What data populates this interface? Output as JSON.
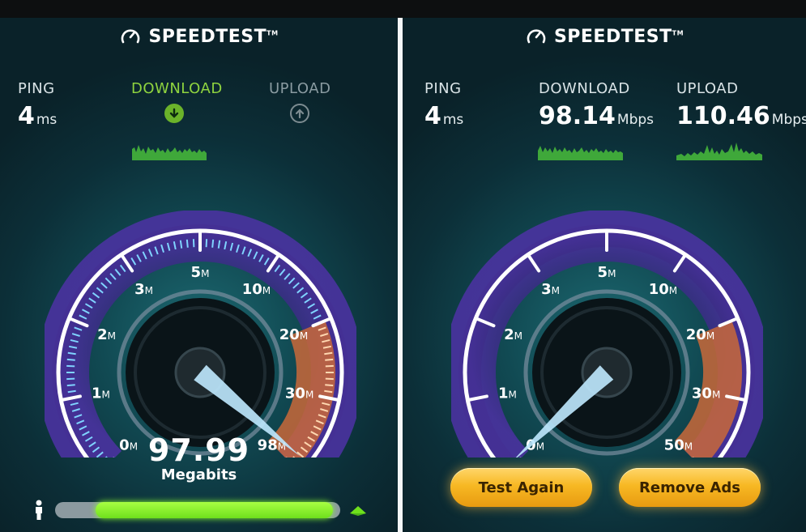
{
  "left": {
    "logo_text": "SPEEDTEST",
    "trademark": "TM",
    "ping": {
      "label": "PING",
      "value": "4",
      "unit": "ms"
    },
    "download": {
      "label": "DOWNLOAD",
      "icon": "arrow-down-icon"
    },
    "upload": {
      "label": "UPLOAD",
      "icon": "arrow-up-icon"
    },
    "gauge": {
      "ticks": [
        "0",
        "1",
        "2",
        "3",
        "5",
        "10",
        "20",
        "30",
        "98"
      ],
      "unit": "M",
      "needle_value": "98"
    },
    "speed": "97.99",
    "speed_unit": "Megabits",
    "progress": 0.97
  },
  "right": {
    "logo_text": "SPEEDTEST",
    "trademark": "TM",
    "ping": {
      "label": "PING",
      "value": "4",
      "unit": "ms"
    },
    "download": {
      "label": "DOWNLOAD",
      "value": "98.14",
      "unit": "Mbps"
    },
    "upload": {
      "label": "UPLOAD",
      "value": "110.46",
      "unit": "Mbps"
    },
    "gauge": {
      "ticks": [
        "0",
        "1",
        "2",
        "3",
        "5",
        "10",
        "20",
        "30",
        "50"
      ],
      "unit": "M"
    },
    "buttons": {
      "test_again": "Test Again",
      "remove_ads": "Remove Ads"
    }
  },
  "colors": {
    "accent_green": "#8fd43f",
    "button_gold": "#f7b823",
    "gauge_orange": "#d4743a",
    "gauge_purple": "#5a3fb0"
  }
}
